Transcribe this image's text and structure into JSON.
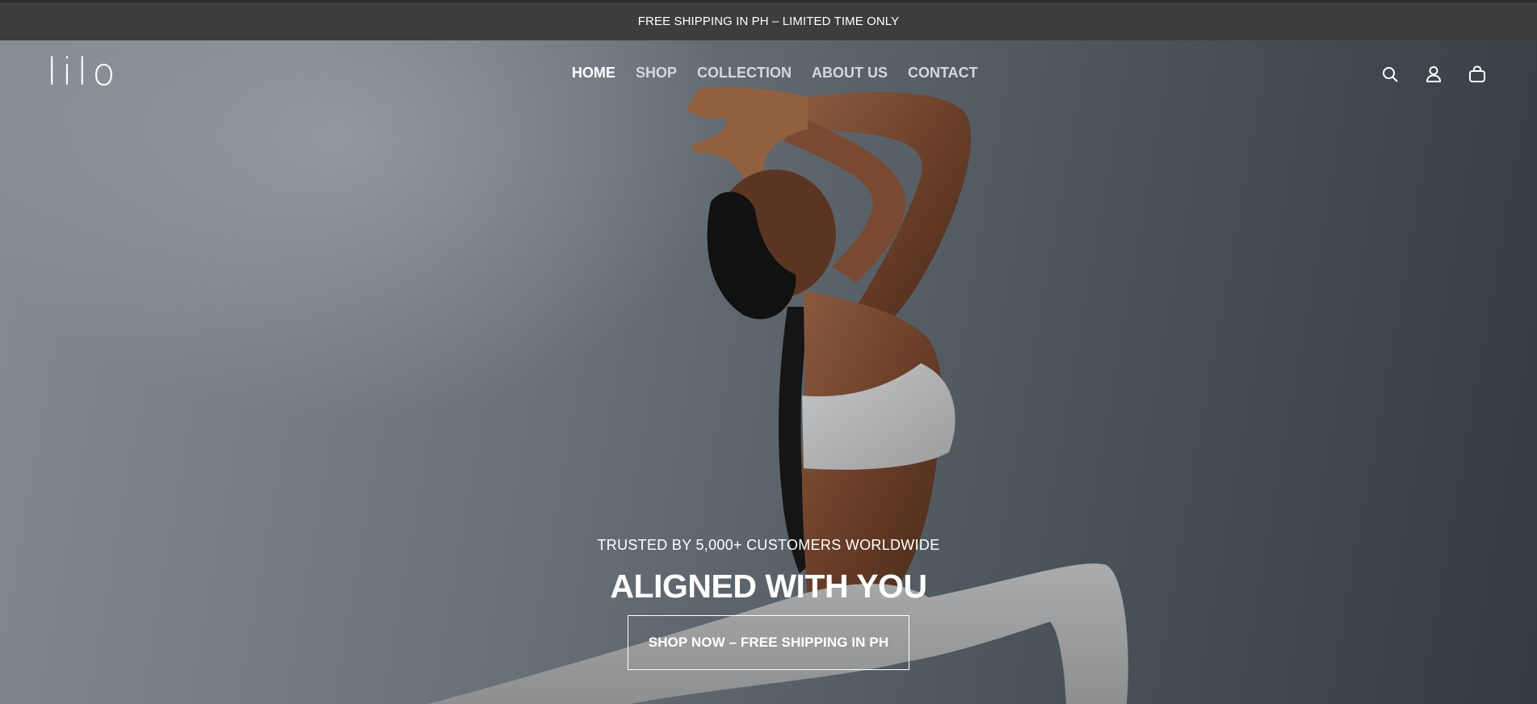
{
  "announcement": {
    "text": "FREE SHIPPING IN PH – LIMITED TIME ONLY"
  },
  "header": {
    "logo": "lilo",
    "nav": [
      {
        "label": "HOME",
        "active": true
      },
      {
        "label": "SHOP",
        "active": false
      },
      {
        "label": "COLLECTION",
        "active": false
      },
      {
        "label": "ABOUT US",
        "active": false
      },
      {
        "label": "CONTACT",
        "active": false
      }
    ],
    "icons": [
      "search-icon",
      "account-icon",
      "cart-icon"
    ]
  },
  "hero": {
    "eyebrow": "TRUSTED BY 5,000+ CUSTOMERS WORLDWIDE",
    "title": "ALIGNED WITH YOU",
    "cta_label": "SHOP NOW – FREE SHIPPING IN PH",
    "image_subject": "woman in low lunge yoga pose, grey sports bra and leggings"
  },
  "colors": {
    "announcement_bg": "#3d3d3d",
    "text": "#ffffff"
  }
}
